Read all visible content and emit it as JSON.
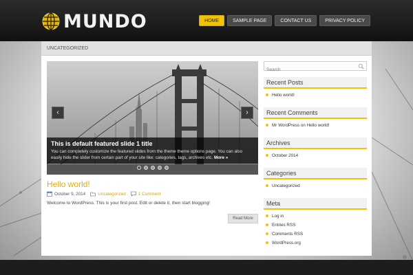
{
  "site": {
    "logo_text": "MUNDO",
    "logo_icon": "globe-icon",
    "accent": "#f0c30b"
  },
  "nav": {
    "items": [
      {
        "label": "Home",
        "active": true
      },
      {
        "label": "Sample Page"
      },
      {
        "label": "Contact Us"
      },
      {
        "label": "Privacy Policy"
      }
    ]
  },
  "breadcrumb": "Uncategorized",
  "slider": {
    "title": "This is default featured slide 1 title",
    "text": "You can completely customize the featured slides from the theme theme options page. You can also easily hide the slider from certain part of your site like: categories, tags, archives etc.",
    "more": "More »",
    "prev_icon": "chevron-left-icon",
    "next_icon": "chevron-right-icon",
    "dots": 5,
    "active_dot": 0
  },
  "post": {
    "title": "Hello world!",
    "date": "October 9, 2014",
    "category": "Uncategorized",
    "comments": "1 Comment",
    "excerpt": "Welcome to WordPress. This is your first post. Edit or delete it, then start blogging!",
    "read_more": "Read More"
  },
  "sidebar": {
    "search_placeholder": "Search",
    "widgets": [
      {
        "title": "Recent Posts",
        "items": [
          "Hello world!"
        ]
      },
      {
        "title": "Recent Comments",
        "items": [
          "Mr WordPress on Hello world!"
        ]
      },
      {
        "title": "Archives",
        "items": [
          "October 2014"
        ]
      },
      {
        "title": "Categories",
        "items": [
          "Uncategorized"
        ]
      },
      {
        "title": "Meta",
        "items": [
          "Log in",
          "Entries RSS",
          "Comments RSS",
          "WordPress.org"
        ]
      }
    ]
  }
}
